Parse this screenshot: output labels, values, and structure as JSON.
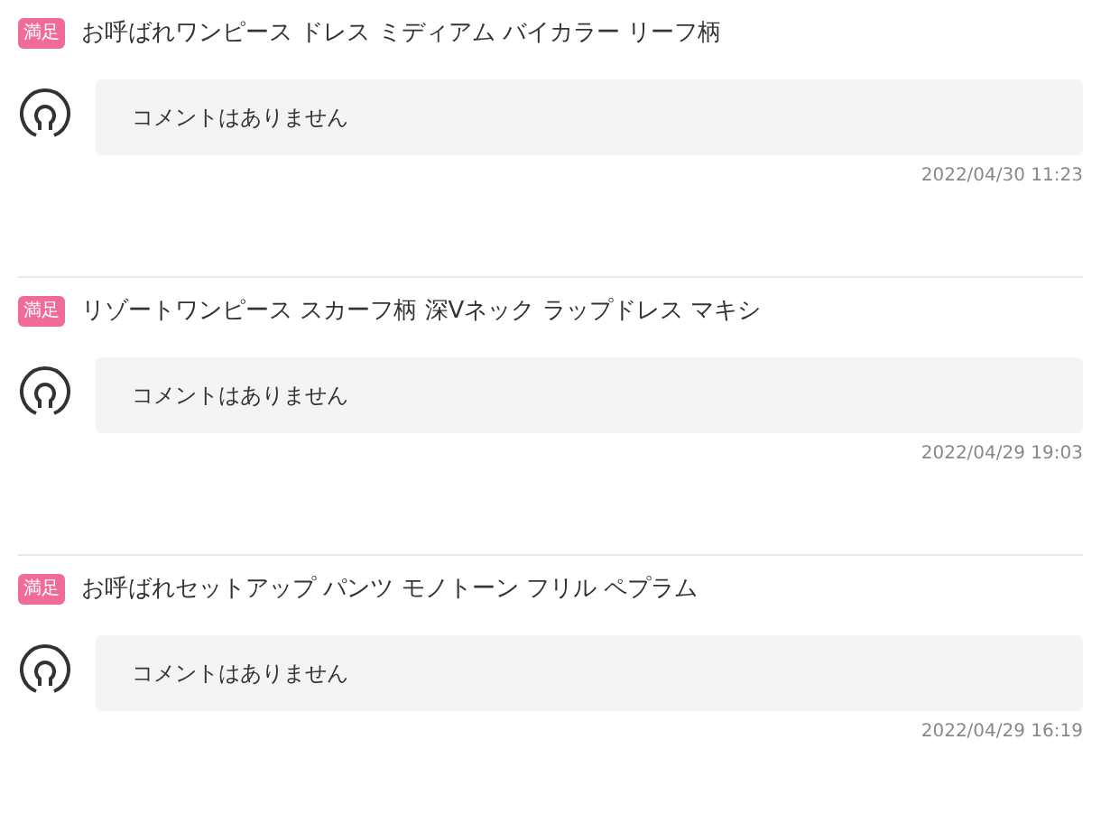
{
  "reviews": [
    {
      "badge": "満足",
      "title": "お呼ばれワンピース ドレス ミディアム バイカラー リーフ柄",
      "comment": "コメントはありません",
      "date": "2022/04/30 11:23"
    },
    {
      "badge": "満足",
      "title": "リゾートワンピース スカーフ柄 深Vネック ラップドレス マキシ",
      "comment": "コメントはありません",
      "date": "2022/04/29 19:03"
    },
    {
      "badge": "満足",
      "title": "お呼ばれセットアップ パンツ モノトーン フリル ペプラム",
      "comment": "コメントはありません",
      "date": "2022/04/29 16:19"
    }
  ]
}
